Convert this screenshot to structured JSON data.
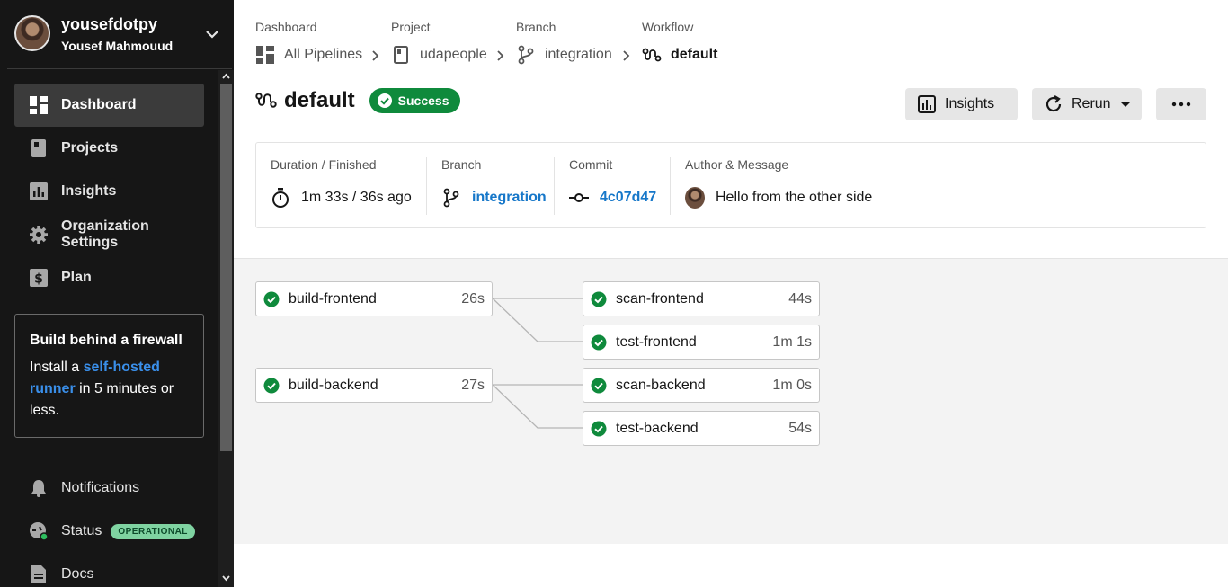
{
  "user": {
    "username": "yousefdotpy",
    "full_name": "Yousef Mahmouud"
  },
  "sidebar": {
    "items": [
      {
        "label": "Dashboard",
        "icon": "dashboard-icon",
        "active": true
      },
      {
        "label": "Projects",
        "icon": "projects-icon"
      },
      {
        "label": "Insights",
        "icon": "insights-icon"
      },
      {
        "label": "Organization Settings",
        "icon": "gear-icon"
      },
      {
        "label": "Plan",
        "icon": "dollar-icon"
      }
    ],
    "promo": {
      "title": "Build behind a firewall",
      "text_before": "Install a ",
      "link": "self-hosted runner",
      "text_after": " in 5 minutes or less."
    },
    "bottom_items": [
      {
        "label": "Notifications",
        "icon": "bell-icon"
      },
      {
        "label": "Status",
        "icon": "status-icon",
        "badge": "OPERATIONAL"
      },
      {
        "label": "Docs",
        "icon": "docs-icon"
      }
    ]
  },
  "breadcrumbs": [
    {
      "label": "Dashboard",
      "value": "All Pipelines",
      "icon": "dashboard-icon"
    },
    {
      "label": "Project",
      "value": "udapeople",
      "icon": "project-icon"
    },
    {
      "label": "Branch",
      "value": "integration",
      "icon": "branch-icon"
    },
    {
      "label": "Workflow",
      "value": "default",
      "icon": "workflow-icon"
    }
  ],
  "header": {
    "title": "default",
    "status": "Success",
    "insights_label": "Insights",
    "rerun_label": "Rerun",
    "more_label": "..."
  },
  "info": {
    "duration_label": "Duration / Finished",
    "duration_value": "1m 33s / 36s ago",
    "branch_label": "Branch",
    "branch_value": "integration",
    "commit_label": "Commit",
    "commit_value": "4c07d47",
    "author_label": "Author & Message",
    "message": "Hello from the other side"
  },
  "jobs": [
    {
      "name": "build-frontend",
      "duration": "26s",
      "status": "success"
    },
    {
      "name": "scan-frontend",
      "duration": "44s",
      "status": "success"
    },
    {
      "name": "test-frontend",
      "duration": "1m 1s",
      "status": "success"
    },
    {
      "name": "build-backend",
      "duration": "27s",
      "status": "success"
    },
    {
      "name": "scan-backend",
      "duration": "1m 0s",
      "status": "success"
    },
    {
      "name": "test-backend",
      "duration": "54s",
      "status": "success"
    }
  ],
  "colors": {
    "success": "#0f8a3c",
    "link": "#1677c9",
    "sidebar_bg": "#161616"
  }
}
